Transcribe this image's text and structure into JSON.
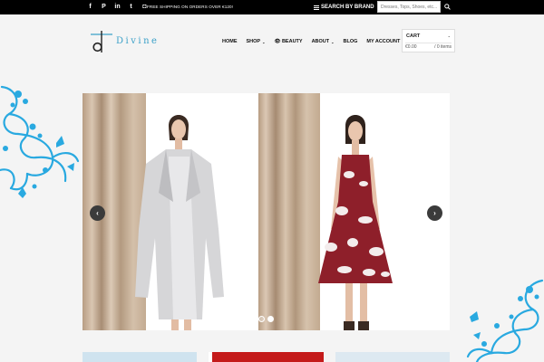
{
  "topbar": {
    "social": [
      {
        "glyph": "f",
        "icon": "facebook-icon"
      },
      {
        "glyph": "P",
        "icon": "pinterest-icon"
      },
      {
        "glyph": "in",
        "icon": "linkedin-icon"
      },
      {
        "glyph": "t",
        "icon": "twitter-icon"
      },
      {
        "glyph": "◘",
        "icon": "instagram-icon"
      }
    ],
    "shipping_text": "FREE SHIPPING ON ORDERS OVER €120!",
    "search_by_brand": "SEARCH BY BRAND",
    "search_placeholder": "Dresses, Tops, Shoes, etc..."
  },
  "header": {
    "logo_text": "Divine",
    "nav": [
      {
        "label": "HOME",
        "dropdown": false
      },
      {
        "label": "SHOP",
        "dropdown": true
      },
      {
        "label": "👁 BEAUTY",
        "dropdown": false
      },
      {
        "label": "ABOUT",
        "dropdown": true
      },
      {
        "label": "BLOG",
        "dropdown": false
      },
      {
        "label": "MY ACCOUNT",
        "dropdown": true
      }
    ],
    "cart": {
      "label": "CART",
      "total": "€0.00",
      "items": "/ 0 items"
    }
  },
  "slider": {
    "prev": "‹",
    "next": "›",
    "slide_count": 2,
    "active_slide": 1
  },
  "colors": {
    "accent": "#3aa0c8",
    "floral": "#29a9e0",
    "topbar": "#000000"
  }
}
